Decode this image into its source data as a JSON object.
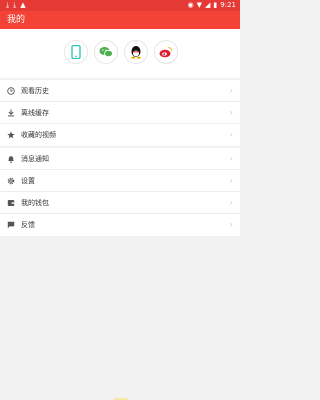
{
  "status_bar": {
    "left_icons": [
      "download-icon",
      "download-icon",
      "android-icon"
    ],
    "time": "9:21"
  },
  "app_bar": {
    "title": "我的"
  },
  "login": {
    "providers": [
      "phone-login",
      "wechat-login",
      "qq-login",
      "weibo-login"
    ]
  },
  "menu_group_1": [
    {
      "label": "观看历史",
      "icon": "clock-icon"
    },
    {
      "label": "离线缓存",
      "icon": "download-icon"
    },
    {
      "label": "收藏的视频",
      "icon": "star-icon"
    }
  ],
  "menu_group_2": [
    {
      "label": "消息通知",
      "icon": "bell-icon"
    },
    {
      "label": "设置",
      "icon": "gear-icon"
    },
    {
      "label": "我的钱包",
      "icon": "wallet-icon"
    },
    {
      "label": "反馈",
      "icon": "feedback-icon"
    }
  ],
  "chevron": "›",
  "colors": {
    "status_bar": "#e53935",
    "app_bar": "#f44336",
    "phone": "#26c6b0",
    "wechat": "#4caf50",
    "weibo": "#e6162d"
  }
}
